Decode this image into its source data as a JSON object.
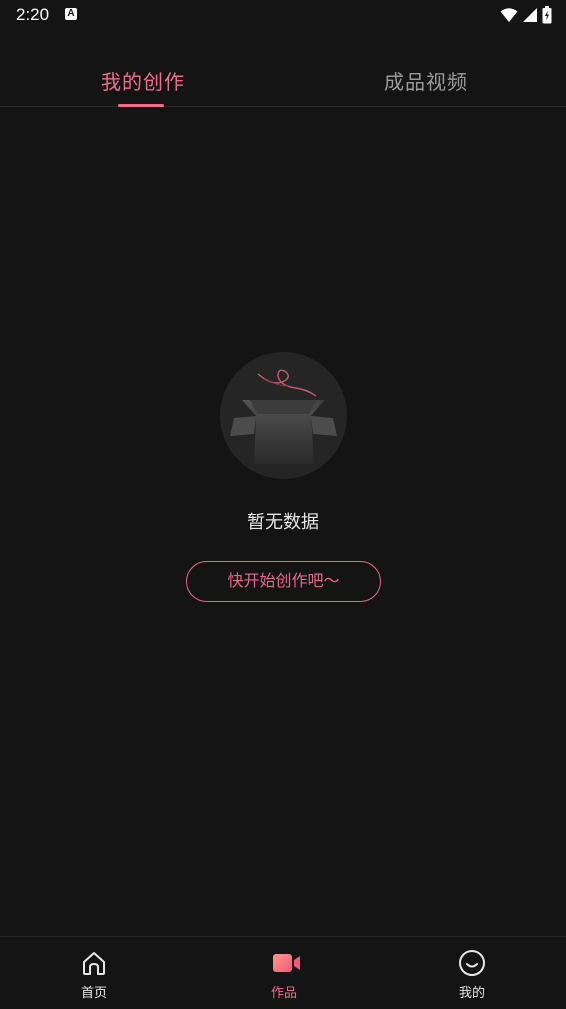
{
  "status_bar": {
    "time": "2:20",
    "notification_icon": "a-icon",
    "icons": [
      "wifi-icon",
      "signal-icon",
      "battery-icon"
    ]
  },
  "tabs": [
    {
      "label": "我的创作",
      "active": true
    },
    {
      "label": "成品视频",
      "active": false
    }
  ],
  "empty_state": {
    "illustration": "empty-box-icon",
    "message": "暂无数据",
    "button_label": "快开始创作吧～"
  },
  "bottom_nav": [
    {
      "label": "首页",
      "icon": "home-icon",
      "active": false
    },
    {
      "label": "作品",
      "icon": "video-camera-icon",
      "active": true
    },
    {
      "label": "我的",
      "icon": "smiley-icon",
      "active": false
    }
  ],
  "colors": {
    "accent": "#f06e8c",
    "background": "#141414",
    "inactive_text": "#9a9a9a"
  }
}
